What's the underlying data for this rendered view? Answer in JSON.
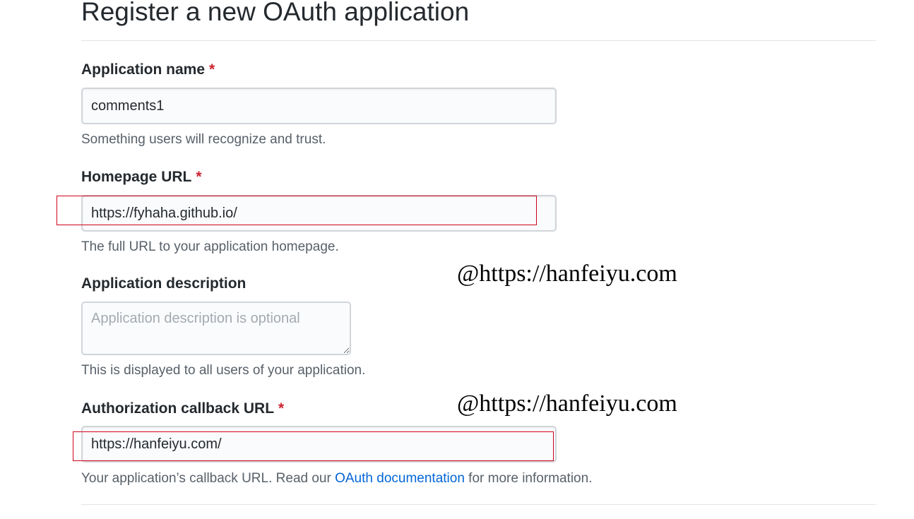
{
  "page": {
    "title": "Register a new OAuth application"
  },
  "form": {
    "app_name": {
      "label": "Application name",
      "required_mark": "*",
      "value": "comments1",
      "note": "Something users will recognize and trust."
    },
    "homepage_url": {
      "label": "Homepage URL",
      "required_mark": "*",
      "value": "https://fyhaha.github.io/",
      "note": "The full URL to your application homepage."
    },
    "description": {
      "label": "Application description",
      "placeholder": "Application description is optional",
      "note": "This is displayed to all users of your application."
    },
    "callback_url": {
      "label": "Authorization callback URL",
      "required_mark": "*",
      "value": "https://hanfeiyu.com/",
      "note_before": "Your application’s callback URL. Read our ",
      "note_link": "OAuth documentation",
      "note_after": " for more information."
    }
  },
  "watermarks": [
    "@https://hanfeiyu.com",
    "@https://hanfeiyu.com"
  ],
  "colors": {
    "required": "#cb2431",
    "link": "#0366d6",
    "highlight_box": "#d0021b",
    "note_text": "#586069"
  }
}
